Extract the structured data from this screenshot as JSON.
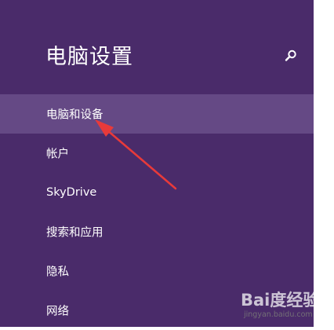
{
  "header": {
    "title": "电脑设置",
    "search_icon": "search-icon"
  },
  "nav": {
    "items": [
      {
        "label": "电脑和设备",
        "selected": true
      },
      {
        "label": "帐户",
        "selected": false
      },
      {
        "label": "SkyDrive",
        "selected": false
      },
      {
        "label": "搜索和应用",
        "selected": false
      },
      {
        "label": "隐私",
        "selected": false
      },
      {
        "label": "网络",
        "selected": false
      }
    ]
  },
  "watermark": {
    "brand": "Bai度经验",
    "url": "jingyan.baidu.com"
  },
  "colors": {
    "panel_background": "#4a2b6a",
    "selected_background": "#654985",
    "annotation_arrow": "#e83a3a"
  }
}
